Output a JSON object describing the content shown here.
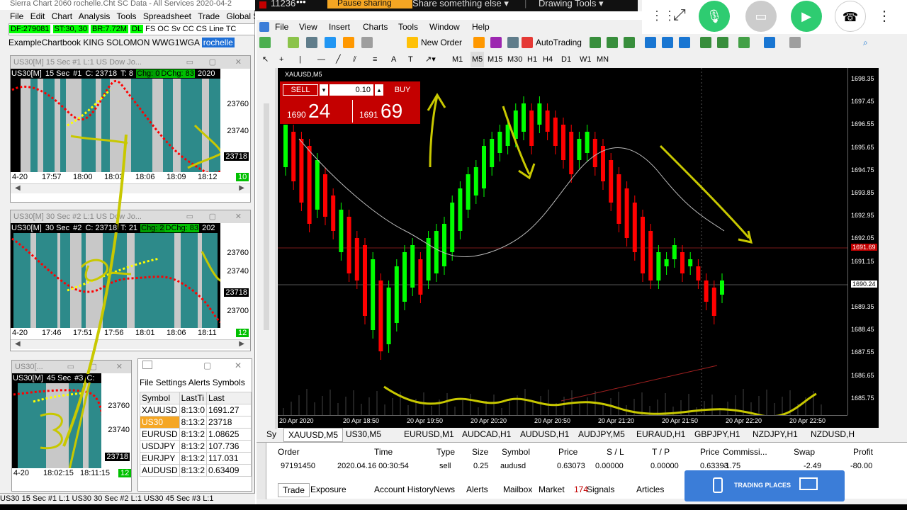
{
  "sierra": {
    "title": "Sierra Chart 2060 rochelle.Cht  SC Data - All Services 2020-04-2",
    "menu": [
      "File",
      "Edit",
      "Chart",
      "Analysis",
      "Tools",
      "Spreadsheet",
      "Trade",
      "Global Settings"
    ],
    "status": {
      "df": "DF:279081",
      "st": "ST:30, 30",
      "br": "BR:7.72M",
      "dl": "DL",
      "items": [
        "FS",
        "OC",
        "Sv",
        "CC",
        "CS"
      ],
      "line": "Line",
      "x": "TC"
    },
    "chartbook": "ExampleChartbook KING SOLOMON WWG1WGA",
    "chartbook_selected": "rochelle",
    "charts": [
      {
        "title": "US30[M]  15 Sec  #1  L:1 US Dow Jo...",
        "head": {
          "sym": "US30[M]",
          "tf": "15 Sec",
          "num": "#1",
          "c": "C: 23718",
          "t": "T: 8",
          "chg": "Chg: 0",
          "dchg": "DChg: 83",
          "yr": "2020"
        },
        "y": [
          "23760",
          "23740",
          "23718"
        ],
        "x": [
          "4-20",
          "17:57",
          "18:00",
          "18:03",
          "18:06",
          "18:09",
          "18:12"
        ],
        "badge": "10"
      },
      {
        "title": "US30[M]  30 Sec  #2  L:1 US Dow Jo...",
        "head": {
          "sym": "US30[M]",
          "tf": "30 Sec",
          "num": "#2",
          "c": "C: 23718",
          "t": "T: 21",
          "chg": "Chg: 2",
          "dchg": "DChg: 83",
          "yr": "202"
        },
        "y": [
          "23760",
          "23740",
          "23718",
          "23700"
        ],
        "x": [
          "4-20",
          "17:46",
          "17:51",
          "17:56",
          "18:01",
          "18:06",
          "18:11"
        ],
        "badge": "12"
      },
      {
        "title": "US30[...",
        "head": {
          "sym": "US30[M]",
          "tf": "45 Sec",
          "num": "#3",
          "c": "C:"
        },
        "y": [
          "23760",
          "23740",
          "23718"
        ],
        "x": [
          "4-20",
          "18:02:15",
          "18:11:15"
        ],
        "badge": "12"
      }
    ],
    "quote_board": {
      "menu": [
        "File",
        "Settings",
        "Alerts",
        "Symbols"
      ],
      "headers": [
        "Symbol",
        "LastTi",
        "Last"
      ],
      "rows": [
        [
          "XAUUSD",
          "8:13:0",
          "1691.27"
        ],
        [
          "US30",
          "8:13:2",
          "23718"
        ],
        [
          "EURUSD",
          "8:13:2",
          "1.08625"
        ],
        [
          "USDJPY",
          "8:13:2",
          "107.736"
        ],
        [
          "EURJPY",
          "8:13:2",
          "117.031"
        ],
        [
          "AUDUSD",
          "8:13:2",
          "0.63409"
        ]
      ]
    },
    "bottom": "US30  15 Sec  #1  L:1  US30  30 Sec  #2  L:1  US30  45 Sec  #3  L:1"
  },
  "share": {
    "id_text": "11236",
    "pause": "Pause sharing",
    "share_else": "Share something else",
    "drawing": "Drawing Tools"
  },
  "mt4": {
    "menu": [
      "File",
      "View",
      "Insert",
      "Charts",
      "Tools",
      "Window",
      "Help"
    ],
    "toolbar": {
      "new_order": "New Order",
      "autotrading": "AutoTrading"
    },
    "timeframes": [
      "M1",
      "M5",
      "M15",
      "M30",
      "H1",
      "H4",
      "D1",
      "W1",
      "MN"
    ],
    "chart_label": "XAUUSD,M5",
    "one_click": {
      "sell": "SELL",
      "buy": "BUY",
      "lot": "0.10",
      "sell_big": "1690",
      "sell_pip": "24",
      "buy_big": "1691",
      "buy_pip": "69"
    },
    "y_axis": [
      "1698.35",
      "1697.45",
      "1696.55",
      "1695.65",
      "1694.75",
      "1693.85",
      "1692.95",
      "1692.05",
      "1691.15",
      "1690.24",
      "1689.35",
      "1688.45",
      "1687.55",
      "1686.65",
      "1685.75"
    ],
    "x_axis": [
      "20 Apr 2020",
      "20 Apr 18:50",
      "20 Apr 19:50",
      "20 Apr 20:20",
      "20 Apr 20:50",
      "20 Apr 21:20",
      "20 Apr 21:50",
      "20 Apr 22:20",
      "20 Apr 22:50"
    ],
    "bid_label": "1690.24",
    "ask_label": "1691.69",
    "chart_tabs": [
      "XAUUSD,M5",
      "US30,M5",
      "EURUSD,M1",
      "AUDCAD,H1",
      "AUDUSD,H1",
      "AUDJPY,M5",
      "EURAUD,H1",
      "GBPJPY,H1",
      "NZDJPY,H1",
      "NZDUSD,H"
    ],
    "terminal": {
      "headers": [
        "Order",
        "Time",
        "Type",
        "Size",
        "Symbol",
        "Price",
        "S / L",
        "T / P",
        "Price",
        "Commissi...",
        "Swap",
        "Profit"
      ],
      "row": [
        "97191450",
        "2020.04.16 00:30:54",
        "sell",
        "0.25",
        "audusd",
        "0.63073",
        "0.00000",
        "0.00000",
        "0.63393",
        "-1.75",
        "-2.49",
        "-80.00"
      ],
      "tabs": [
        "Trade",
        "Exposure",
        "Account History",
        "News",
        "Alerts",
        "Mailbox",
        "Market",
        "Signals",
        "Articles"
      ],
      "market_badge": "174"
    },
    "logo": "TRADING PLACES"
  },
  "colors": {
    "bull": "#00ff00",
    "bear": "#ff0000",
    "annot": "#c8c800",
    "sell": "#c40000"
  }
}
